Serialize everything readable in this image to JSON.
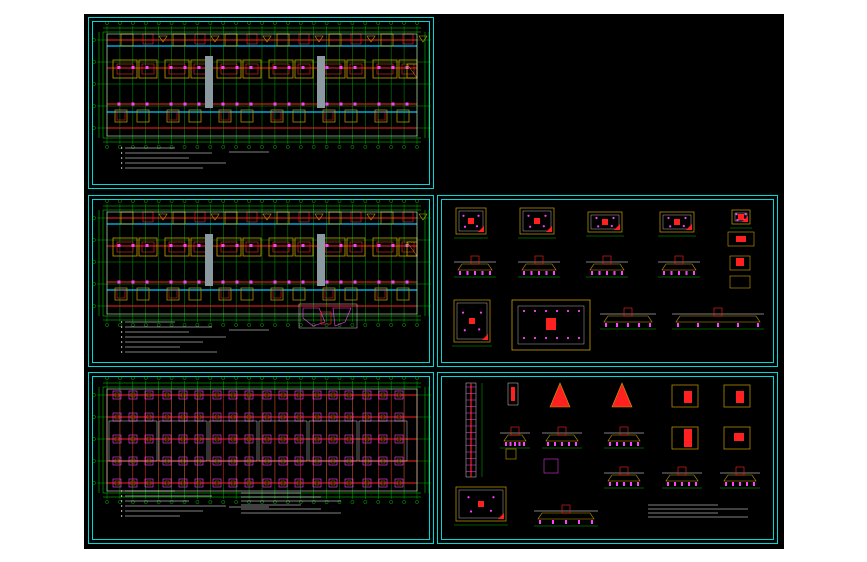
{
  "app": {
    "title": "",
    "background": "#ffffff",
    "canvas_color": "#000000"
  },
  "colors": {
    "frame": "#00d8d8",
    "dim": "#00e000",
    "wall": "#ff2020",
    "footing": "#c8a000",
    "pink": "#ff40ff",
    "white": "#ffffff",
    "cyan": "#00c8ff"
  },
  "sheets": [
    {
      "id": "foundation-plan-1",
      "kind": "plan",
      "notes": 5
    },
    {
      "id": "foundation-plan-2",
      "kind": "plan",
      "notes": 7
    },
    {
      "id": "foundation-plan-3",
      "kind": "plan",
      "notes": 6
    },
    {
      "id": "details-sheet-1",
      "kind": "details"
    },
    {
      "id": "details-sheet-2",
      "kind": "details"
    }
  ]
}
